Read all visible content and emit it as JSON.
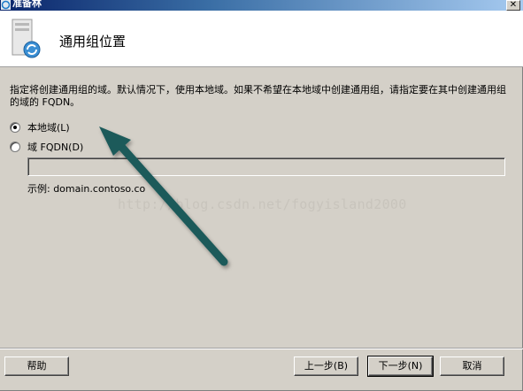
{
  "window": {
    "title": "准备林",
    "close_glyph": "✕"
  },
  "header": {
    "title": "通用组位置",
    "icon": "server-sync-icon"
  },
  "instruction": "指定将创建通用组的域。默认情况下，使用本地域。如果不希望在本地域中创建通用组，请指定要在其中创建通用组的域的 FQDN。",
  "options": {
    "local_domain": {
      "label": "本地域(L)",
      "checked": true
    },
    "fqdn_domain": {
      "label": "域 FQDN(D)",
      "checked": false
    }
  },
  "fqdn_input": {
    "value": ""
  },
  "example": "示例: domain.contoso.co",
  "watermark": "http://blog.csdn.net/fogyisland2000",
  "buttons": {
    "help": "帮助",
    "back": "上一步(B)",
    "next": "下一步(N)",
    "cancel": "取消"
  },
  "colors": {
    "arrow": "#1c5a5a",
    "title_bar": "#0a246a"
  }
}
